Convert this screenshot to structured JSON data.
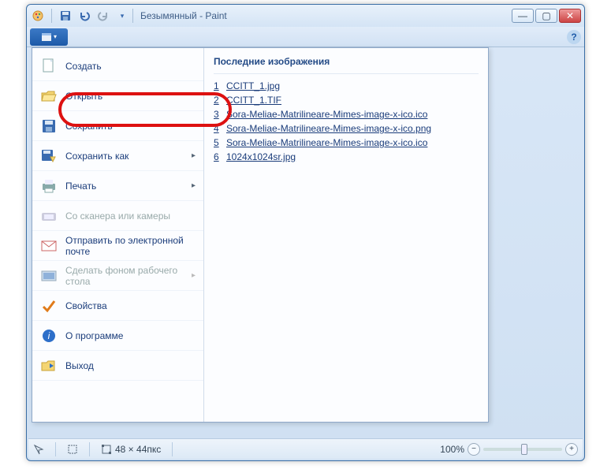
{
  "window": {
    "title": "Безымянный - Paint"
  },
  "menu": {
    "new": "Создать",
    "open": "Открыть",
    "save": "Сохранить",
    "save_as": "Сохранить как",
    "print": "Печать",
    "from_scanner": "Со сканера или камеры",
    "send_email": "Отправить по электронной почте",
    "set_wallpaper": "Сделать фоном рабочего стола",
    "properties": "Свойства",
    "about": "О программе",
    "exit": "Выход"
  },
  "recent": {
    "header": "Последние изображения",
    "items": [
      "CCITT_1.jpg",
      "CCITT_1.TIF",
      "Sora-Meliae-Matrilineare-Mimes-image-x-ico.ico",
      "Sora-Meliae-Matrilineare-Mimes-image-x-ico.png",
      "Sora-Meliae-Matrilineare-Mimes-image-x-ico.ico",
      "1024x1024sr.jpg"
    ]
  },
  "status": {
    "dimensions": "48 × 44пкс",
    "zoom": "100%"
  }
}
